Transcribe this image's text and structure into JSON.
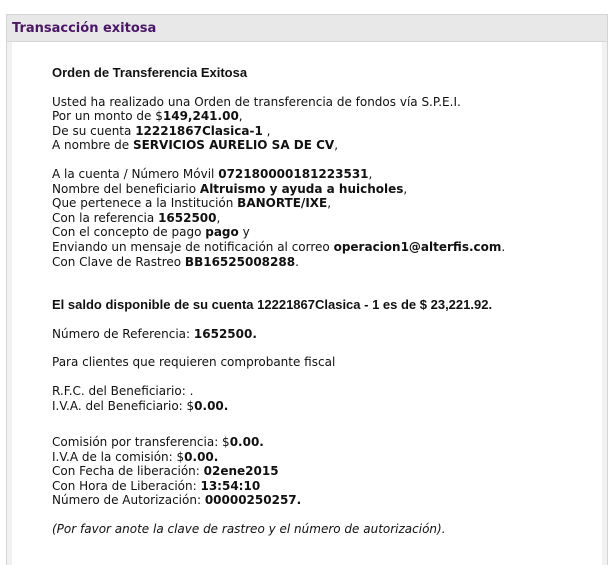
{
  "panel": {
    "title": "Transacción exitosa"
  },
  "order": {
    "heading": "Orden de Transferencia Exitosa",
    "intro": "Usted ha realizado una Orden de transferencia de fondos vía S.P.E.I.",
    "amount_label": "Por un monto de $",
    "amount": "149,241.00",
    "amount_suffix": ",",
    "account_label": "De su cuenta ",
    "account": "12221867Clasica-1",
    "account_suffix": " ,",
    "name_label": "A nombre de ",
    "name": "SERVICIOS AURELIO SA DE CV",
    "name_suffix": ","
  },
  "destination": {
    "account_label": "A la cuenta / Número Móvil ",
    "account": "072180000181223531",
    "account_suffix": ",",
    "beneficiary_label": "Nombre del beneficiario ",
    "beneficiary": "Altruismo y ayuda a huicholes",
    "beneficiary_suffix": ",",
    "institution_label": "Que pertenece a la Institución ",
    "institution": "BANORTE/IXE",
    "institution_suffix": ",",
    "reference_label": "Con la referencia ",
    "reference": "1652500",
    "reference_suffix": ",",
    "concept_label": "Con el concepto de pago ",
    "concept": "pago",
    "concept_suffix": " y",
    "email_label": "Enviando un mensaje de notificación al correo ",
    "email": "operacion1@alterfis.com",
    "email_suffix": ".",
    "tracking_label": "Con Clave de Rastreo ",
    "tracking": "BB16525008288",
    "tracking_suffix": "."
  },
  "balance": {
    "text": "El saldo disponible de su cuenta 12221867Clasica - 1 es de $ 23,221.92."
  },
  "reference_number": {
    "label": "Número de Referencia: ",
    "value": "1652500."
  },
  "fiscal": {
    "text": "Para clientes que requieren comprobante fiscal",
    "rfc_label": "R.F.C. del Beneficiario: ",
    "rfc_value": ".",
    "iva_label": "I.V.A. del Beneficiario: $",
    "iva_value": "0.00."
  },
  "fees": {
    "commission_label": "Comisión por transferencia: $",
    "commission": "0.00.",
    "iva_label": "I.V.A de la comisión: $",
    "iva": "0.00.",
    "date_label": "Con Fecha de liberación: ",
    "date": "02ene2015",
    "time_label": "Con Hora de Liberación: ",
    "time": "13:54:10",
    "auth_label": "Número de Autorización: ",
    "auth": "00000250257."
  },
  "note": "(Por favor anote la clave de rastreo y el número de autorización)."
}
